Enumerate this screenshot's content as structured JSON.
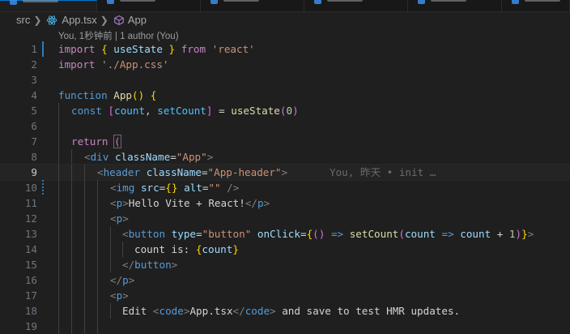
{
  "breadcrumb": {
    "folder": "src",
    "file": "App.tsx",
    "symbol": "App"
  },
  "blame_header": "You, 1秒钟前 | 1 author (You)",
  "inline_blame": "You, 昨天 • init …",
  "line_numbers": [
    "1",
    "2",
    "3",
    "4",
    "5",
    "6",
    "7",
    "8",
    "9",
    "10",
    "11",
    "12",
    "13",
    "14",
    "15",
    "16",
    "17",
    "18",
    "19"
  ],
  "code": {
    "l1": [
      "import",
      " ",
      "{",
      " ",
      "useState",
      " ",
      "}",
      " ",
      "from",
      " ",
      "'react'"
    ],
    "l2": [
      "import",
      " ",
      "'./App.css'"
    ],
    "l4": [
      "function",
      " ",
      "App",
      "(",
      ")",
      " ",
      "{"
    ],
    "l5": [
      "const",
      " ",
      "[",
      "count",
      ",",
      " ",
      "setCount",
      "]",
      " = ",
      "useState",
      "(",
      "0",
      ")"
    ],
    "l7": [
      "return",
      " ",
      "("
    ],
    "l8": [
      "<",
      "div",
      " ",
      "className",
      "=",
      "\"App\"",
      ">"
    ],
    "l9": [
      "<",
      "header",
      " ",
      "className",
      "=",
      "\"App-header\"",
      ">"
    ],
    "l10": [
      "<",
      "img",
      " ",
      "src",
      "=",
      "{",
      "}",
      " ",
      "alt",
      "=",
      "\"\"",
      " ",
      "/>"
    ],
    "l11": [
      "<",
      "p",
      ">",
      "Hello Vite + React!",
      "</",
      "p",
      ">"
    ],
    "l12": [
      "<",
      "p",
      ">"
    ],
    "l13": [
      "<",
      "button",
      " ",
      "type",
      "=",
      "\"button\"",
      " ",
      "onClick",
      "=",
      "{",
      "(",
      ")",
      " ",
      "=>",
      " ",
      "setCount",
      "(",
      "count",
      " ",
      "=>",
      " ",
      "count",
      " + ",
      "1",
      ")",
      "}",
      ">"
    ],
    "l14": [
      "count is: ",
      "{",
      "count",
      "}"
    ],
    "l15": [
      "</",
      "button",
      ">"
    ],
    "l16": [
      "</",
      "p",
      ">"
    ],
    "l17": [
      "<",
      "p",
      ">"
    ],
    "l18": [
      "Edit ",
      "<",
      "code",
      ">",
      "App.tsx",
      "</",
      "code",
      ">",
      " and save to test HMR updates."
    ]
  },
  "colors": {
    "background": "#1f1f1f",
    "keyword": "#c586c0",
    "storage": "#569cd6",
    "function": "#dcdcaa",
    "variable": "#9cdcfe",
    "constant": "#4fc1ff",
    "string": "#ce9178",
    "number": "#b5cea8",
    "git_modified": "#2e7bbd"
  },
  "icons": {
    "react": "react-icon",
    "component": "cube-icon"
  }
}
